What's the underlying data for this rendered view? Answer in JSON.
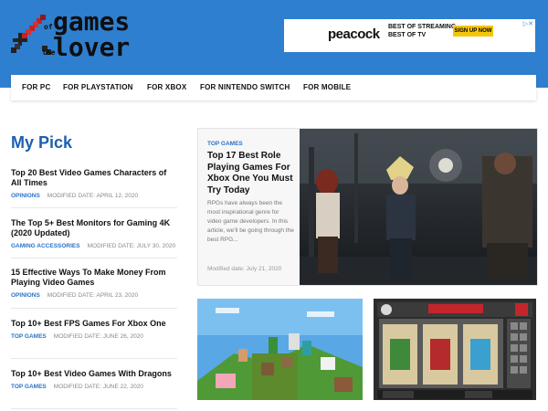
{
  "site": {
    "logo_line1": "games",
    "logo_line2": "lover",
    "logo_small1": "of",
    "logo_small2": "the"
  },
  "ad": {
    "brand": "peacock",
    "line1": "BEST OF STREAMING",
    "line2": "BEST OF TV",
    "cta": "SIGN UP NOW"
  },
  "nav": {
    "items": [
      {
        "label": "FOR PC"
      },
      {
        "label": "FOR PLAYSTATION"
      },
      {
        "label": "FOR XBOX"
      },
      {
        "label": "FOR NINTENDO SWITCH"
      },
      {
        "label": "FOR MOBILE"
      }
    ]
  },
  "sidebar": {
    "heading": "My Pick",
    "items": [
      {
        "title": "Top 20 Best Video Games Characters of All Times",
        "category": "OPINIONS",
        "date": "MODIFIED DATE: APRIL 12, 2020"
      },
      {
        "title": "The Top 5+ Best Monitors for Gaming 4K (2020 Updated)",
        "category": "GAMING ACCESSORIES",
        "date": "MODIFIED DATE: JULY 30, 2020"
      },
      {
        "title": "15 Effective Ways To Make Money From Playing Video Games",
        "category": "OPINIONS",
        "date": "MODIFIED DATE: APRIL 23, 2020"
      },
      {
        "title": "Top 10+ Best FPS Games For Xbox One",
        "category": "TOP GAMES",
        "date": "MODIFIED DATE: JUNE 26, 2020"
      },
      {
        "title": "Top 10+ Best Video Games With Dragons",
        "category": "TOP GAMES",
        "date": "MODIFIED DATE: JUNE 22, 2020"
      }
    ]
  },
  "featured": {
    "category": "TOP GAMES",
    "title": "Top 17 Best Role Playing Games For Xbox One You Must Try Today",
    "excerpt": "RPGs have always been the most inspirational genre for video game developers. In this article, we'll be going through the best RPG...",
    "date": "Modified date: July 21, 2020"
  },
  "colors": {
    "header_bg": "#2f7fd0",
    "accent": "#2a73c8",
    "heading": "#1f5fb0"
  }
}
